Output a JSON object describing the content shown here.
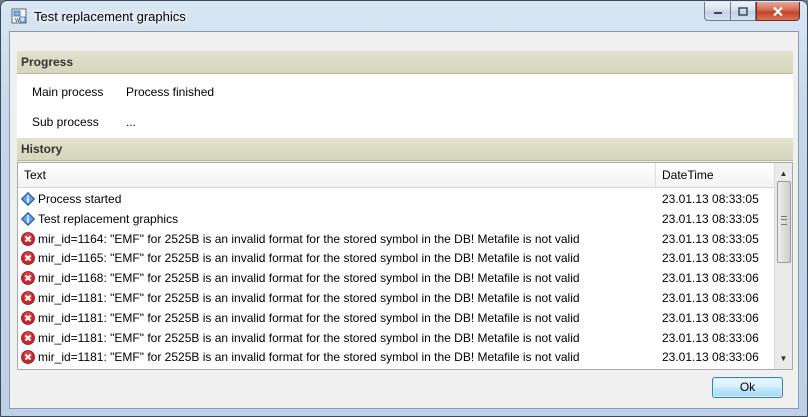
{
  "window": {
    "title": "Test replacement graphics",
    "app_icon": "graphics-window-icon"
  },
  "progress": {
    "header": "Progress",
    "main_label": "Main process",
    "main_value": "Process finished",
    "sub_label": "Sub process",
    "sub_value": "..."
  },
  "history": {
    "header": "History",
    "columns": [
      "Text",
      "DateTime"
    ],
    "rows": [
      {
        "icon": "info",
        "text": "Process started",
        "datetime": "23.01.13 08:33:05"
      },
      {
        "icon": "info",
        "text": "Test replacement graphics",
        "datetime": "23.01.13 08:33:05"
      },
      {
        "icon": "error",
        "text": "mir_id=1164: \"EMF\" for 2525B is an invalid format for the stored symbol in the DB! Metafile is not valid",
        "datetime": "23.01.13 08:33:05"
      },
      {
        "icon": "error",
        "text": "mir_id=1165: \"EMF\" for 2525B is an invalid format for the stored symbol in the DB! Metafile is not valid",
        "datetime": "23.01.13 08:33:05"
      },
      {
        "icon": "error",
        "text": "mir_id=1168: \"EMF\" for 2525B is an invalid format for the stored symbol in the DB! Metafile is not valid",
        "datetime": "23.01.13 08:33:06"
      },
      {
        "icon": "error",
        "text": "mir_id=1181: \"EMF\" for 2525B is an invalid format for the stored symbol in the DB! Metafile is not valid",
        "datetime": "23.01.13 08:33:06"
      },
      {
        "icon": "error",
        "text": "mir_id=1181: \"EMF\" for 2525B is an invalid format for the stored symbol in the DB! Metafile is not valid",
        "datetime": "23.01.13 08:33:06"
      },
      {
        "icon": "error",
        "text": "mir_id=1181: \"EMF\" for 2525B is an invalid format for the stored symbol in the DB! Metafile is not valid",
        "datetime": "23.01.13 08:33:06"
      },
      {
        "icon": "error",
        "text": "mir_id=1181: \"EMF\" for 2525B is an invalid format for the stored symbol in the DB! Metafile is not valid",
        "datetime": "23.01.13 08:33:06"
      }
    ]
  },
  "buttons": {
    "ok_label": "Ok"
  },
  "colors": {
    "section_header_bg": "#d9d9c1",
    "info_icon": "#2f6fd0",
    "error_icon": "#c8242a",
    "close_button": "#c8432a"
  }
}
